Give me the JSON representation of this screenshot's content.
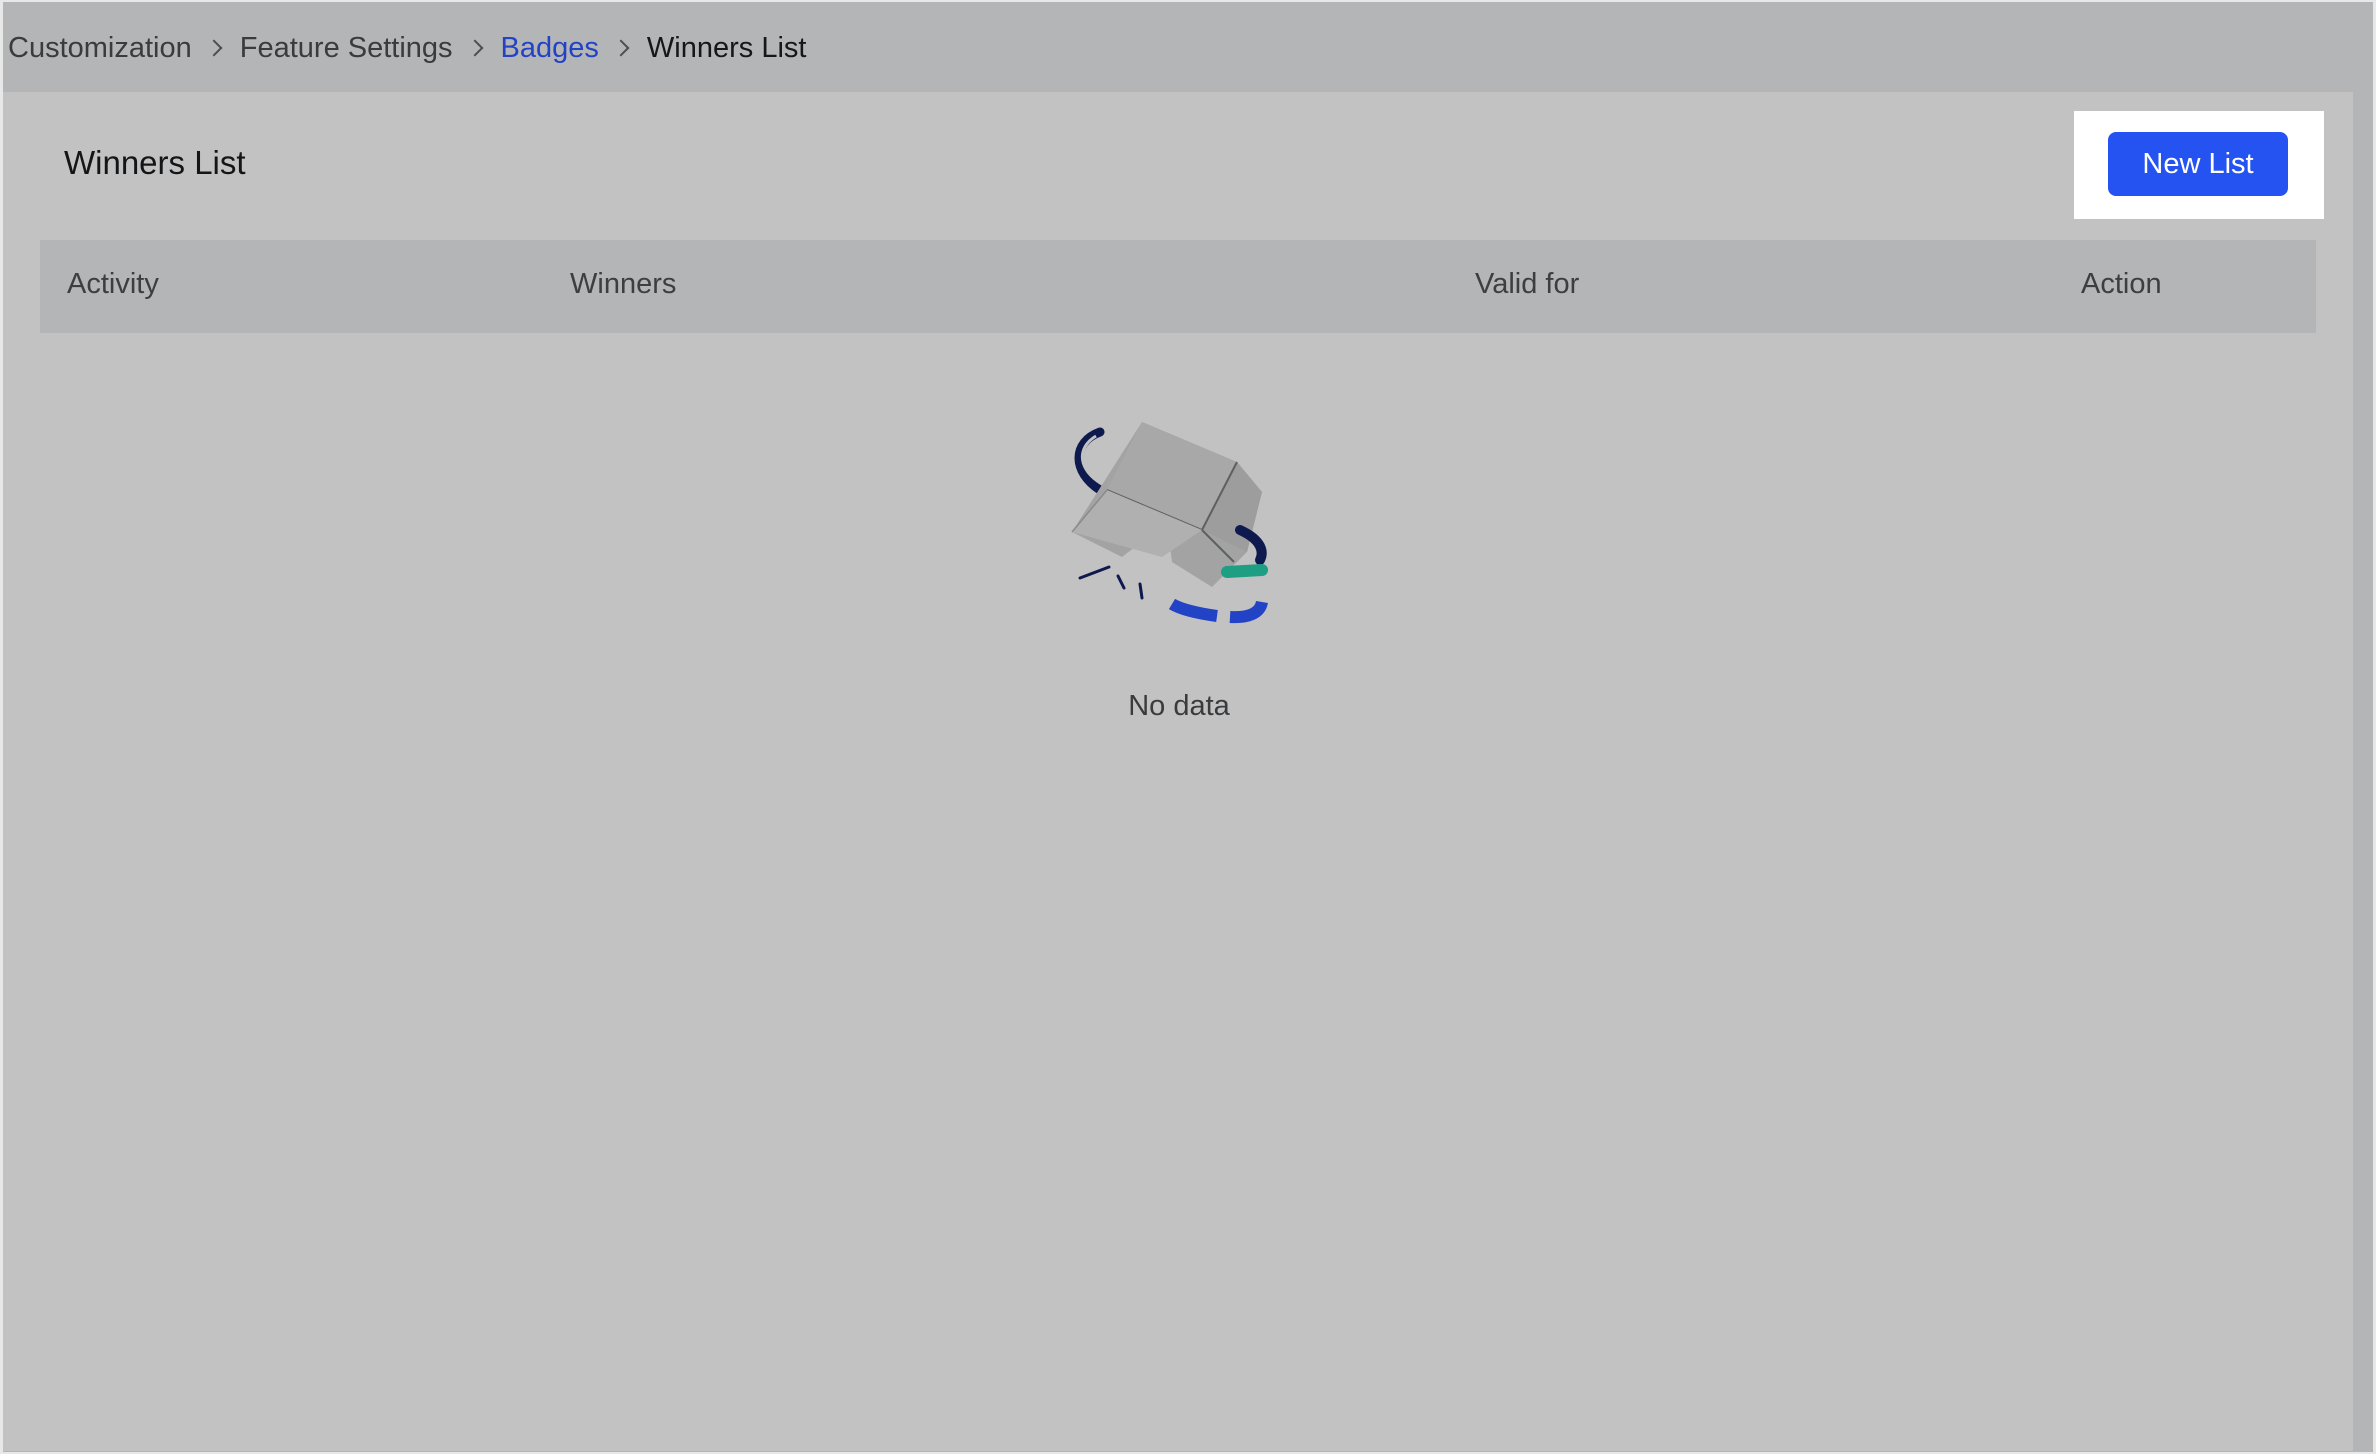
{
  "breadcrumb": {
    "items": [
      {
        "label": "Customization",
        "state": "default"
      },
      {
        "label": "Feature Settings",
        "state": "default"
      },
      {
        "label": "Badges",
        "state": "link"
      },
      {
        "label": "Winners List",
        "state": "current"
      }
    ]
  },
  "page": {
    "title": "Winners List",
    "new_button_label": "New List"
  },
  "table": {
    "columns": [
      "Activity",
      "Winners",
      "Valid for",
      "Action"
    ],
    "rows": [],
    "empty_text": "No data"
  },
  "icons": {
    "separator": "chevron-right-icon",
    "empty": "empty-box-icon"
  },
  "colors": {
    "primary": "#2553f2",
    "link": "#2343c7",
    "accent_green": "#1e9e82",
    "accent_navy": "#0e1a4d"
  }
}
